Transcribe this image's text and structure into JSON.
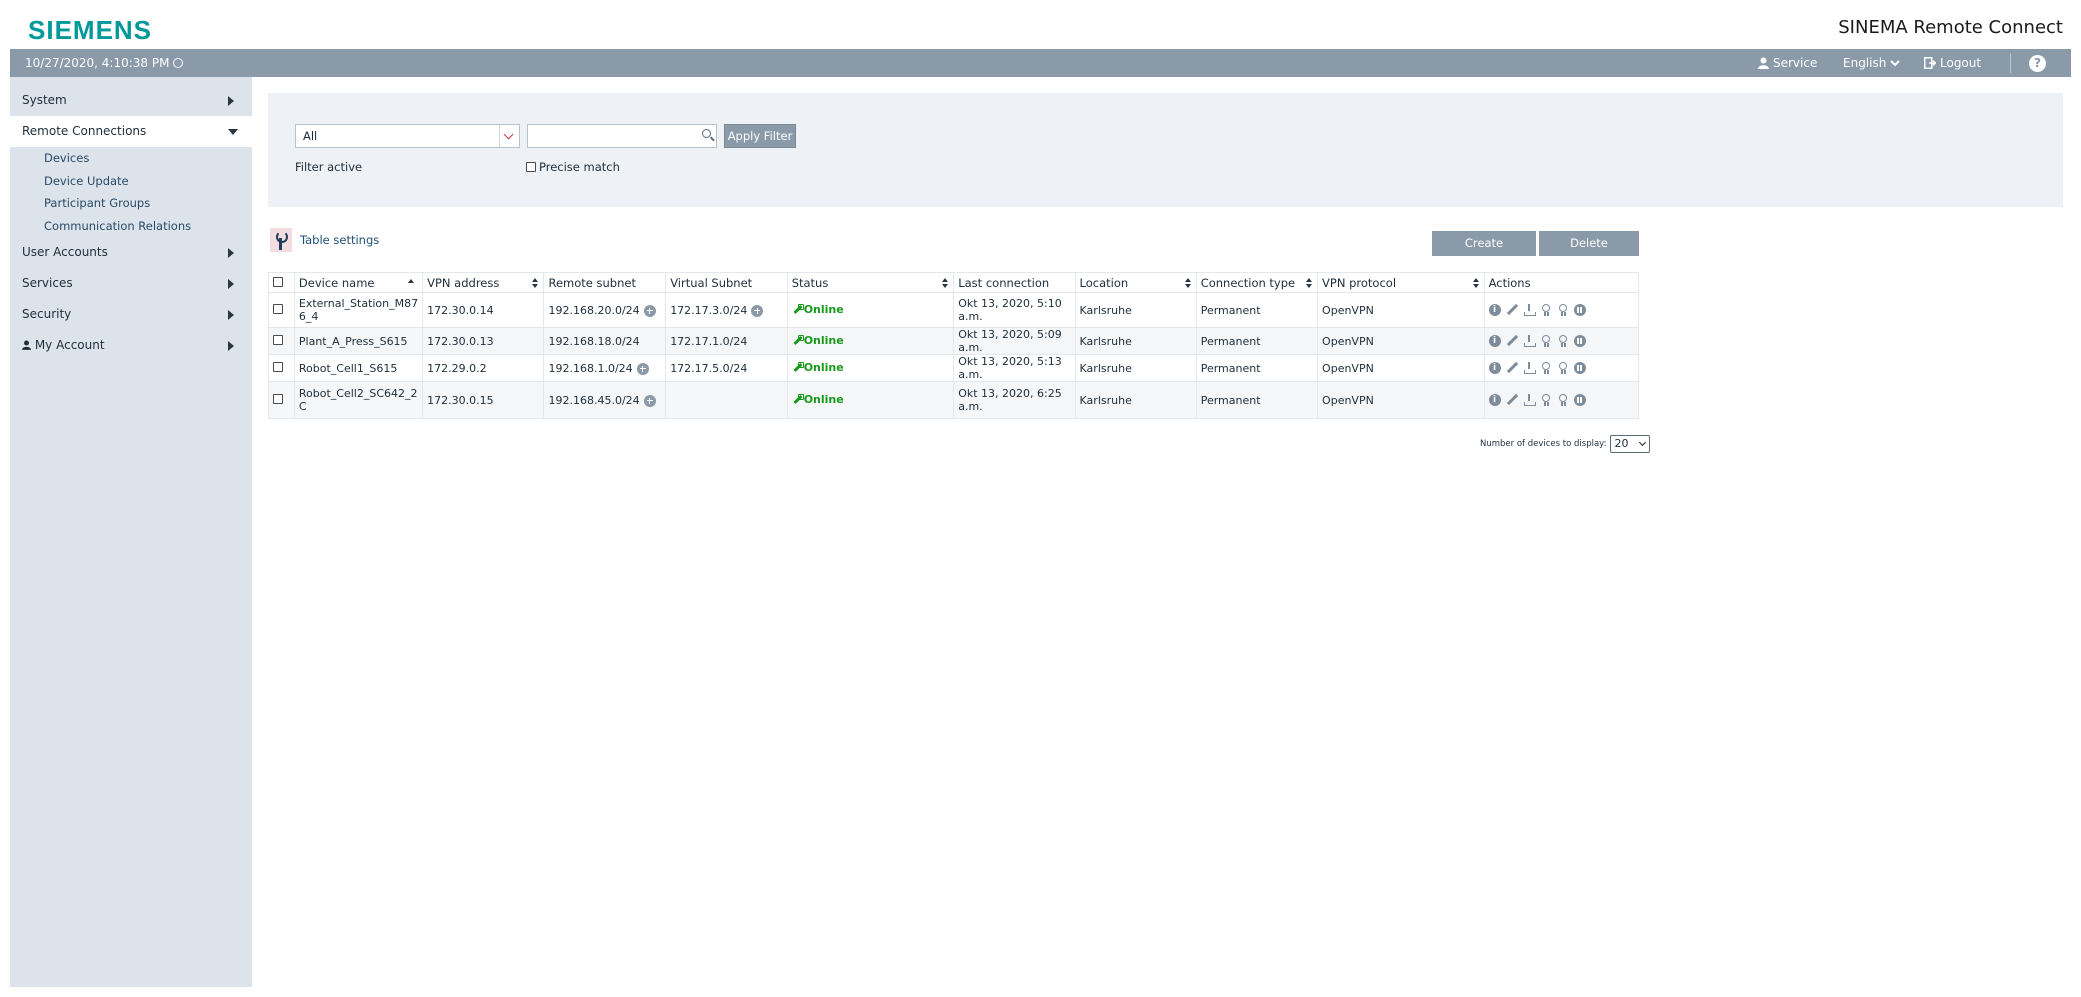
{
  "header": {
    "logo": "SIEMENS",
    "product": "SINEMA Remote Connect",
    "datetime": "10/27/2020, 4:10:38 PM",
    "service": "Service",
    "language": "English",
    "logout": "Logout",
    "help": "?"
  },
  "sidebar": {
    "items": [
      {
        "label": "System"
      },
      {
        "label": "Remote Connections"
      },
      {
        "label": "User Accounts"
      },
      {
        "label": "Services"
      },
      {
        "label": "Security"
      },
      {
        "label": "My Account"
      }
    ],
    "sub_items": [
      {
        "label": "Devices"
      },
      {
        "label": "Device Update"
      },
      {
        "label": "Participant Groups"
      },
      {
        "label": "Communication Relations"
      }
    ]
  },
  "filter": {
    "select_value": "All",
    "search_value": "",
    "apply_label": "Apply Filter",
    "filter_active": "Filter active",
    "precise_match": "Precise match"
  },
  "toolbar": {
    "table_settings": "Table settings",
    "create": "Create",
    "delete": "Delete"
  },
  "table": {
    "columns": [
      "Device name",
      "VPN address",
      "Remote subnet",
      "Virtual Subnet",
      "Status",
      "Last connection",
      "Location",
      "Connection type",
      "VPN protocol",
      "Actions"
    ],
    "rows": [
      {
        "name": "External_Station_M87 6_4",
        "vpn": "172.30.0.14",
        "remote": "192.168.20.0/24",
        "virtual": "172.17.3.0/24",
        "status": "Online",
        "last": "Okt 13, 2020, 5:10 a.m.",
        "location": "Karlsruhe",
        "conn": "Permanent",
        "proto": "OpenVPN"
      },
      {
        "name": "Plant_A_Press_S615",
        "vpn": "172.30.0.13",
        "remote": "192.168.18.0/24",
        "virtual": "172.17.1.0/24",
        "status": "Online",
        "last": "Okt 13, 2020, 5:09 a.m.",
        "location": "Karlsruhe",
        "conn": "Permanent",
        "proto": "OpenVPN"
      },
      {
        "name": "Robot_Cell1_S615",
        "vpn": "172.29.0.2",
        "remote": "192.168.1.0/24",
        "virtual": "172.17.5.0/24",
        "status": "Online",
        "last": "Okt 13, 2020, 5:13 a.m.",
        "location": "Karlsruhe",
        "conn": "Permanent",
        "proto": "OpenVPN"
      },
      {
        "name": "Robot_Cell2_SC642_2 C",
        "vpn": "172.30.0.15",
        "remote": "192.168.45.0/24",
        "virtual": "",
        "status": "Online",
        "last": "Okt 13, 2020, 6:25 a.m.",
        "location": "Karlsruhe",
        "conn": "Permanent",
        "proto": "OpenVPN"
      }
    ]
  },
  "pager": {
    "label": "Number of devices to display:",
    "value": "20"
  },
  "colors": {
    "brand": "#009999",
    "bar": "#8a9aa8",
    "sidebar": "#dce3eb",
    "online": "#1a9a1a"
  }
}
